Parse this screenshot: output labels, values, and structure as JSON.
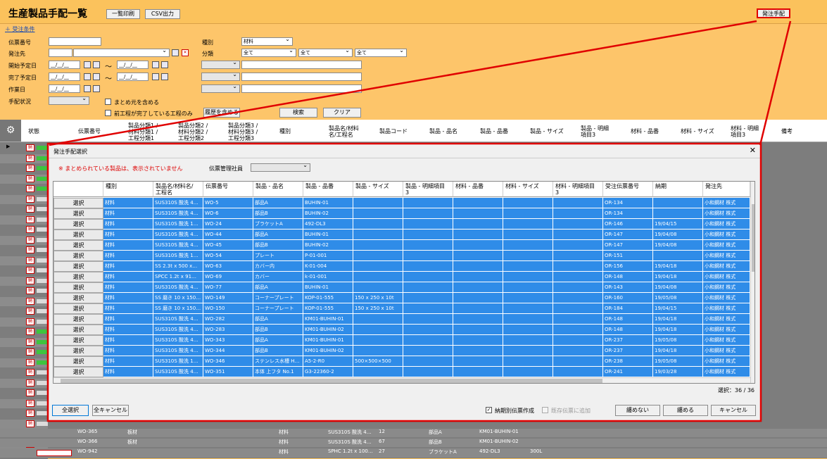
{
  "app": {
    "title": "生産製品手配一覧",
    "print_label": "一覧印刷",
    "csv_label": "CSV出力",
    "order_btn": "発注手配"
  },
  "filter": {
    "toggle": "＋ 受注条件",
    "labels": [
      "伝票番号",
      "発注先",
      "開始予定日",
      "完了予定日",
      "作業日",
      "手配状況"
    ],
    "date_placeholder": "__/__/__",
    "tilde": "～",
    "kind_label": "種別",
    "kind_value": "材料",
    "class_label": "分類",
    "class_values": [
      "全て",
      "全て",
      "全て"
    ],
    "check_include_parent": "まとめ元を含める",
    "check_prev_done": "前工程が完了している工程のみ",
    "history_btn": "履歴を含める",
    "search_btn": "検索",
    "clear_btn": "クリア"
  },
  "grid": {
    "headers": [
      "状態",
      "伝票番号",
      "製品分類1 /\n材料分類1 /\n工程分類1",
      "製品分類2 /\n材料分類2 /\n工程分類2",
      "製品分類3 /\n材料分類3 /\n工程分類3",
      "種別",
      "製品名/材料\n名/工程名",
      "製品コード",
      "製品 - 品名",
      "製品 - 品番",
      "製品 - サイズ",
      "製品 - 明細\n項目3",
      "材料 - 品番",
      "材料 - サイズ",
      "材料 - 明細\n項目3",
      "備考"
    ],
    "badge": "納",
    "bottom_rows": [
      {
        "no": "WO-365",
        "class": "板材",
        "kind": "材料",
        "name": "SUS310S 酸洗 4…",
        "code": "12",
        "pname": "部品A",
        "pno": "KM01-BUHIN-01",
        "size": ""
      },
      {
        "no": "WO-366",
        "class": "板材",
        "kind": "材料",
        "name": "SUS310S 酸洗 4…",
        "code": "67",
        "pname": "部品B",
        "pno": "KM01-BUHIN-02",
        "size": ""
      },
      {
        "no": "WO-942",
        "class": "",
        "kind": "材料",
        "name": "SPHC 1.2t x 100…",
        "code": "27",
        "pname": "ブラケットA",
        "pno": "492-DL3",
        "size": "300L"
      }
    ]
  },
  "modal": {
    "title": "発注手配選択",
    "note": "※ まとめられている製品は、表示されていません",
    "staff_label": "伝票管理社員",
    "headers": [
      "種別",
      "製品名/材料名/\n工程名",
      "伝票番号",
      "製品 - 品名",
      "製品 - 品番",
      "製品 - サイズ",
      "製品 - 明細項目\n3",
      "材料 - 品番",
      "材料 - サイズ",
      "材料 - 明細項目\n3",
      "受注伝票番号",
      "納期",
      "発注先"
    ],
    "select_label": "選択",
    "rows": [
      [
        "材料",
        "SUS310S 酸洗 4…",
        "WO-5",
        "部品A",
        "BUHIN-01",
        "",
        "",
        "",
        "",
        "",
        "OR-134",
        "",
        "小和鋼材 株式"
      ],
      [
        "材料",
        "SUS310S 酸洗 4…",
        "WO-6",
        "部品B",
        "BUHIN-02",
        "",
        "",
        "",
        "",
        "",
        "OR-134",
        "",
        "小和鋼材 株式"
      ],
      [
        "材料",
        "SUS310S 酸洗 1…",
        "WO-24",
        "ブラケットA",
        "492-DL3",
        "",
        "",
        "",
        "",
        "",
        "OR-146",
        "19/04/15",
        "小和鋼材 株式"
      ],
      [
        "材料",
        "SUS310S 酸洗 4…",
        "WO-44",
        "部品A",
        "BUHIN-01",
        "",
        "",
        "",
        "",
        "",
        "OR-147",
        "19/04/08",
        "小和鋼材 株式"
      ],
      [
        "材料",
        "SUS310S 酸洗 4…",
        "WO-45",
        "部品B",
        "BUHIN-02",
        "",
        "",
        "",
        "",
        "",
        "OR-147",
        "19/04/08",
        "小和鋼材 株式"
      ],
      [
        "材料",
        "SUS310S 酸洗 1…",
        "WO-54",
        "プレート",
        "P-01-001",
        "",
        "",
        "",
        "",
        "",
        "OR-151",
        "",
        "小和鋼材 株式"
      ],
      [
        "材料",
        "SS 2.3t x 500 x…",
        "WO-63",
        "カバー内",
        "K-01-004",
        "",
        "",
        "",
        "",
        "",
        "OR-156",
        "19/04/18",
        "小和鋼材 株式"
      ],
      [
        "材料",
        "SPCC 1.2t x 91…",
        "WO-69",
        "カバー",
        "k-01-001",
        "",
        "",
        "",
        "",
        "",
        "OR-148",
        "19/04/18",
        "小和鋼材 株式"
      ],
      [
        "材料",
        "SUS310S 酸洗 4…",
        "WO-77",
        "部品A",
        "BUHIN-01",
        "",
        "",
        "",
        "",
        "",
        "OR-143",
        "19/04/08",
        "小和鋼材 株式"
      ],
      [
        "材料",
        "SS 磨き 10 x 150…",
        "WO-149",
        "コーナープレート",
        "KOP-01-555",
        "150 x 250 x 10t",
        "",
        "",
        "",
        "",
        "OR-160",
        "19/05/08",
        "小和鋼材 株式"
      ],
      [
        "材料",
        "SS 磨き 10 x 150…",
        "WO-150",
        "コーナープレート",
        "KOP-01-555",
        "150 x 250 x 10t",
        "",
        "",
        "",
        "",
        "OR-184",
        "19/04/15",
        "小和鋼材 株式"
      ],
      [
        "材料",
        "SUS310S 酸洗 4…",
        "WO-282",
        "部品A",
        "KM01-BUHIN-01",
        "",
        "",
        "",
        "",
        "",
        "OR-148",
        "19/04/18",
        "小和鋼材 株式"
      ],
      [
        "材料",
        "SUS310S 酸洗 4…",
        "WO-283",
        "部品B",
        "KM01-BUHIN-02",
        "",
        "",
        "",
        "",
        "",
        "OR-148",
        "19/04/18",
        "小和鋼材 株式"
      ],
      [
        "材料",
        "SUS310S 酸洗 4…",
        "WO-343",
        "部品A",
        "KM01-BUHIN-01",
        "",
        "",
        "",
        "",
        "",
        "OR-237",
        "19/05/08",
        "小和鋼材 株式"
      ],
      [
        "材料",
        "SUS310S 酸洗 4…",
        "WO-344",
        "部品B",
        "KM01-BUHIN-02",
        "",
        "",
        "",
        "",
        "",
        "OR-237",
        "19/04/18",
        "小和鋼材 株式"
      ],
      [
        "材料",
        "SUS310S 酸洗 1…",
        "WO-346",
        "ステンレス水槽 H…",
        "A5-2-R0",
        "500×500×500",
        "",
        "",
        "",
        "",
        "OR-238",
        "19/05/08",
        "小和鋼材 株式"
      ],
      [
        "材料",
        "SUS310S 酸洗 4…",
        "WO-351",
        "本体 上フタ No.1",
        "G3-22360-2",
        "",
        "",
        "",
        "",
        "",
        "OR-241",
        "19/03/28",
        "小和鋼材 株式"
      ]
    ],
    "count": "選択：36 / 36",
    "select_all": "全選択",
    "cancel_all": "全キャンセル",
    "chk_per_supplier": "納期別伝票作成",
    "chk_existing": "既存伝票に追加",
    "btn_no_merge": "纏めない",
    "btn_merge": "纏める",
    "btn_cancel": "キャンセル"
  },
  "colors": {
    "accent": "#fbc25c",
    "selection": "#2f8ce8",
    "annotation": "#e00000"
  }
}
